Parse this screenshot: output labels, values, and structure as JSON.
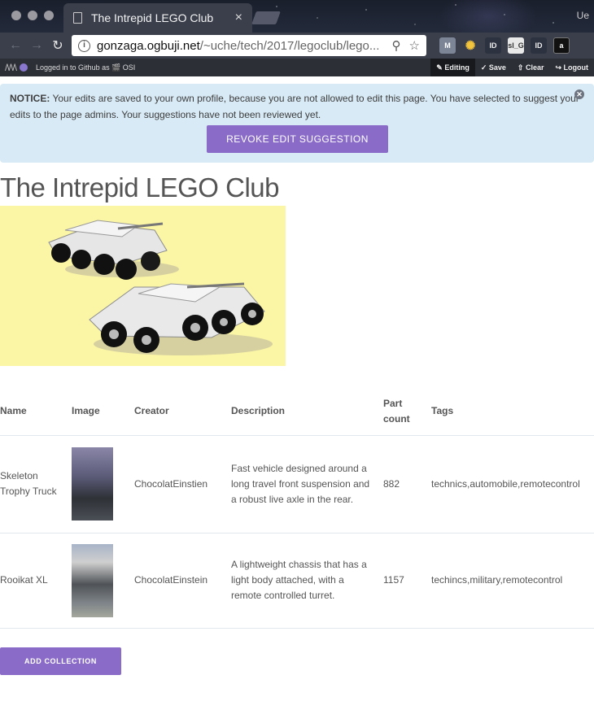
{
  "browser": {
    "tab_title": "The Intrepid LEGO Club",
    "tab_close": "×",
    "profile": "Ue",
    "url_host": "gonzaga.ogbuji.net",
    "url_path": "/~uche/tech/2017/legoclub/lego...",
    "extensions": [
      "M",
      "✺",
      "ID",
      "sl_G",
      "ID",
      "a"
    ]
  },
  "editbar": {
    "logo": "/\\/\\/\\",
    "logged_in": "Logged in to Github as 🎬 OSI",
    "editing": "✎ Editing",
    "save": "✓ Save",
    "clear": "⇧ Clear",
    "logout": "↪ Logout"
  },
  "notice": {
    "label": "NOTICE:",
    "text": " Your edits are saved to your own profile, because you are not allowed to edit this page. You have selected to suggest your edits to the page admins. Your suggestions have not been reviewed yet.",
    "revoke_label": "REVOKE EDIT SUGGESTION",
    "close": "✕"
  },
  "page": {
    "title": "The Intrepid LEGO Club",
    "add_collection_label": "ADD COLLECTION"
  },
  "table": {
    "headers": [
      "Name",
      "Image",
      "Creator",
      "Description",
      "Part count",
      "Tags"
    ],
    "rows": [
      {
        "name": "Skeleton Trophy Truck",
        "creator": "ChocolatEinstien",
        "description": "Fast vehicle designed around a long travel front suspension and a robust live axle in the rear.",
        "part_count": "882",
        "tags": "technics,automobile,remotecontrol"
      },
      {
        "name": "Rooikat XL",
        "creator": "ChocolatEinstein",
        "description": "A lightweight chassis that has a light body attached, with a remote controlled turret.",
        "part_count": "1157",
        "tags": "techincs,military,remotecontrol"
      }
    ]
  },
  "colors": {
    "accent": "#8a6cc8",
    "notice_bg": "#d8eaf6",
    "hero_bg": "#fbf5a6"
  }
}
